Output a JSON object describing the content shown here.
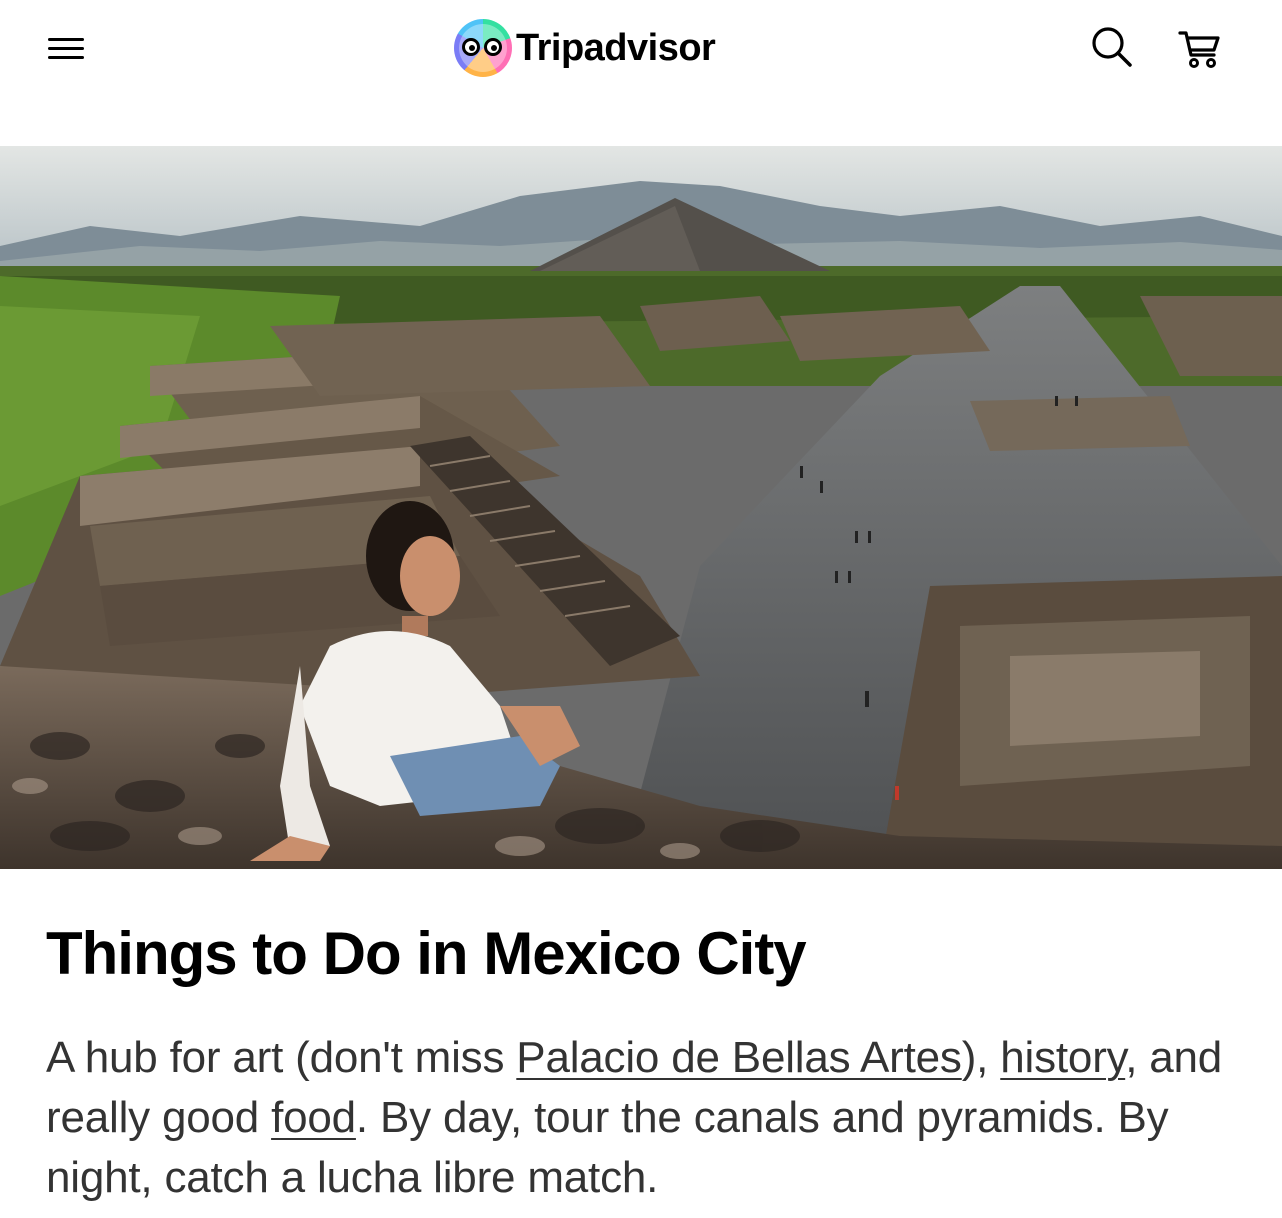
{
  "header": {
    "menu_icon": "hamburger-menu-icon",
    "brand": "Tripadvisor",
    "logo_icon": "owl-eyes-icon",
    "search_icon": "search-icon",
    "cart_icon": "cart-icon"
  },
  "hero": {
    "image_subject": "Teotihuacan pyramids with a woman sitting on ancient stones",
    "colors": {
      "sky": "#c9d1d3",
      "mountain": "#6f7d86",
      "vegetation": "#5c7a2f",
      "stone": "#6b5a4b",
      "avenue": "#5d5f62"
    }
  },
  "main": {
    "title": "Things to Do in Mexico City",
    "intro": {
      "part1": "A hub for art (don't miss ",
      "link1": "Palacio de Bellas Artes",
      "part2": "), ",
      "link2": "history",
      "part3": ", and really good ",
      "link3": "food",
      "part4": ". By day, tour the canals and pyramids. By night, catch a lucha libre match."
    }
  }
}
